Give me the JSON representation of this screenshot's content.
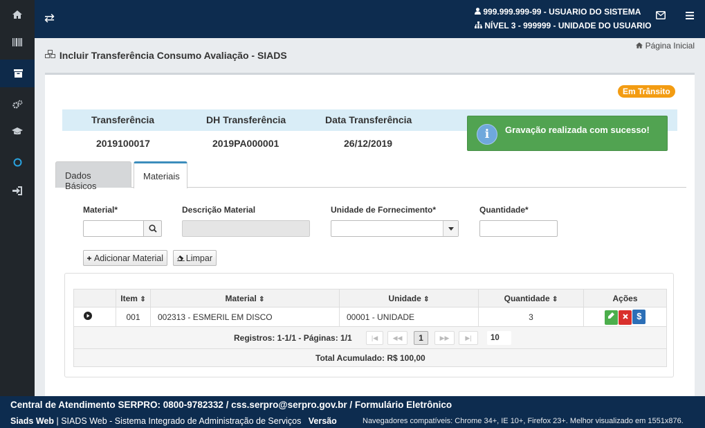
{
  "topbar": {
    "user": "999.999.999-99 - USUARIO DO SISTEMA",
    "level": "NÍVEL 3 - 999999 - UNIDADE DO USUARIO"
  },
  "sidebar": {
    "items": [
      "home-icon",
      "barcode-icon",
      "archive-icon",
      "cogs-icon",
      "graduation-cap-icon",
      "circle-icon",
      "sign-in-icon"
    ]
  },
  "page": {
    "home_link": "Página Inicial",
    "title": "Incluir Transferência Consumo Avaliação - SIADS",
    "status": "Em Trânsito"
  },
  "info": {
    "headers": [
      "Transferência",
      "DH Transferência",
      "Data Transferência"
    ],
    "values": [
      "2019100017",
      "2019PA000001",
      "26/12/2019"
    ]
  },
  "toast": {
    "message": "Gravação realizada com sucesso!"
  },
  "tabs": {
    "basic": "Dados Básicos",
    "materials": "Materiais"
  },
  "form": {
    "material_label": "Material*",
    "description_label": "Descrição Material",
    "unit_label": "Unidade de Fornecimento*",
    "quantity_label": "Quantidade*",
    "add_button": "Adicionar Material",
    "clear_button": "Limpar"
  },
  "grid": {
    "columns": [
      "Item",
      "Material",
      "Unidade",
      "Quantidade",
      "Ações"
    ],
    "rows": [
      {
        "item": "001",
        "material": "002313 - ESMERIL EM DISCO",
        "unit": "00001 - UNIDADE",
        "quantity": "3"
      }
    ],
    "pager_text": "Registros: 1-1/1 - Páginas: 1/1",
    "current_page": "1",
    "page_size": "10",
    "total": "Total Acumulado: R$ 100,00"
  },
  "footer": {
    "contact": "Central de Atendimento SERPRO: 0800-9782332 / css.serpro@serpro.gov.br / Formulário Eletrônico",
    "app_name": "Siads Web",
    "app_desc": "SIADS Web - Sistema Integrado de Administração de Serviços",
    "version_label": "Versão",
    "browsers": "Navegadores compatíveis: Chrome 34+, IE 10+, Firefox 23+. Melhor visualizado em 1551x876."
  },
  "colors": {
    "topbar": "#0d2c4f",
    "sidebar": "#21262b",
    "toast": "#51a351",
    "badge": "#f39c12",
    "tab_active": "#3c8dbc"
  }
}
